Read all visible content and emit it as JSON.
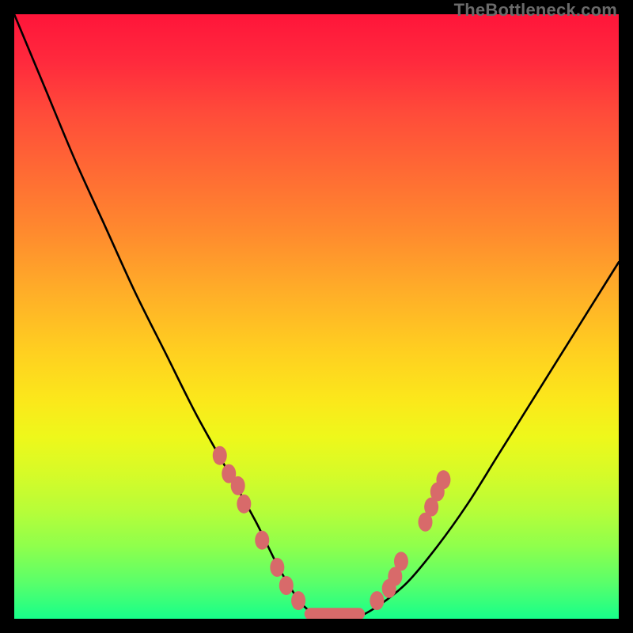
{
  "watermark": "TheBottleneck.com",
  "chart_data": {
    "type": "line",
    "title": "",
    "xlabel": "",
    "ylabel": "",
    "xlim": [
      0,
      100
    ],
    "ylim": [
      0,
      100
    ],
    "series": [
      {
        "name": "curve",
        "x": [
          0,
          5,
          10,
          15,
          20,
          25,
          30,
          35,
          40,
          44,
          48,
          52,
          56,
          60,
          65,
          70,
          75,
          80,
          85,
          90,
          95,
          100
        ],
        "y": [
          100,
          88,
          76,
          65,
          54,
          44,
          34,
          25,
          16,
          8,
          2,
          0,
          0,
          2,
          6,
          12,
          19,
          27,
          35,
          43,
          51,
          59
        ]
      }
    ],
    "markers_left": [
      {
        "x": 34.0,
        "y": 27.0
      },
      {
        "x": 35.5,
        "y": 24.0
      },
      {
        "x": 37.0,
        "y": 22.0
      },
      {
        "x": 38.0,
        "y": 19.0
      },
      {
        "x": 41.0,
        "y": 13.0
      },
      {
        "x": 43.5,
        "y": 8.5
      },
      {
        "x": 45.0,
        "y": 5.5
      },
      {
        "x": 47.0,
        "y": 3.0
      }
    ],
    "markers_right": [
      {
        "x": 60.0,
        "y": 3.0
      },
      {
        "x": 62.0,
        "y": 5.0
      },
      {
        "x": 63.0,
        "y": 7.0
      },
      {
        "x": 64.0,
        "y": 9.5
      },
      {
        "x": 68.0,
        "y": 16.0
      },
      {
        "x": 69.0,
        "y": 18.5
      },
      {
        "x": 70.0,
        "y": 21.0
      },
      {
        "x": 71.0,
        "y": 23.0
      }
    ],
    "valley_bar": {
      "x0": 48,
      "x1": 58,
      "y": 0.8,
      "h": 2.0
    },
    "colors": {
      "curve": "#000000",
      "marker_fill": "#d86a6a",
      "marker_stroke": "#c24d4d",
      "bar_fill": "#d86a6a"
    }
  }
}
